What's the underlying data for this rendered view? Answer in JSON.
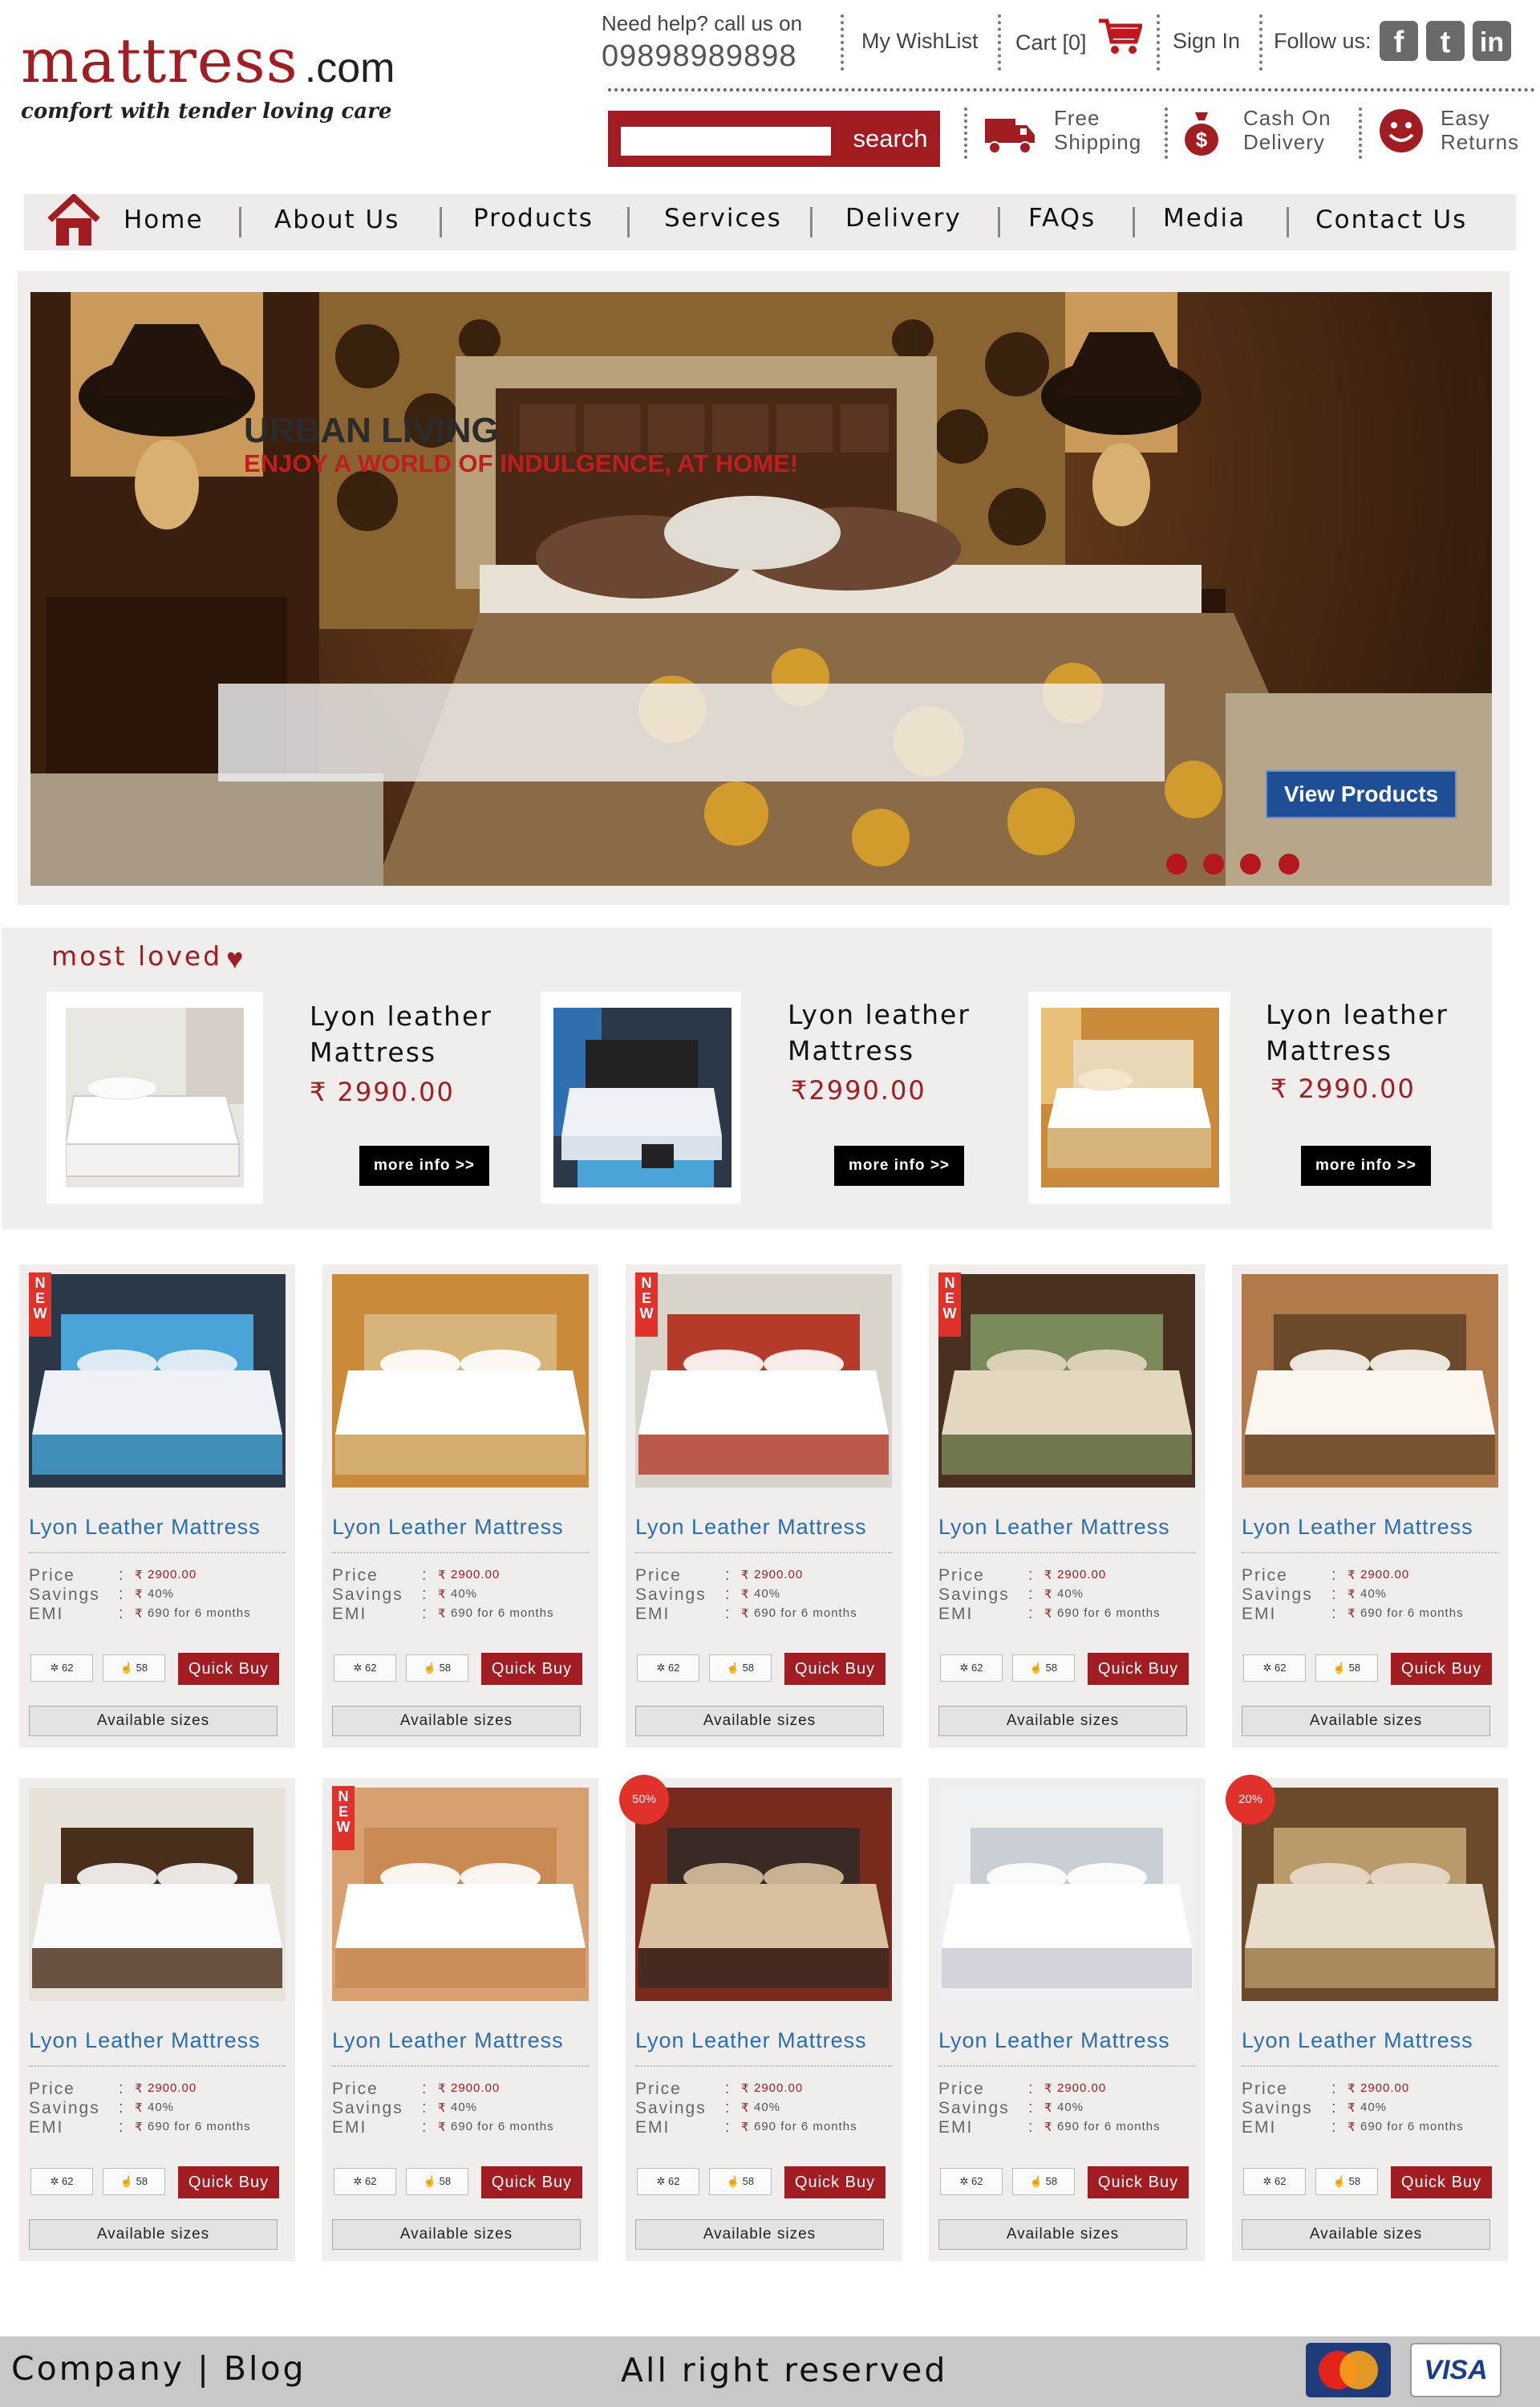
{
  "brand": {
    "logo_main": "mattress",
    "logo_domain": ".com",
    "tagline": "comfort with tender loving care",
    "accent_color": "#a11d21"
  },
  "header": {
    "help_text": "Need help? call us on",
    "phone": "09898989898",
    "wishlist": "My WishList",
    "cart": "Cart [0]",
    "signin": "Sign In",
    "follow": "Follow us:",
    "social": [
      "f",
      "t",
      "in"
    ],
    "search_placeholder": "",
    "search_button": "search",
    "features": [
      {
        "icon": "truck-icon",
        "line1": "Free",
        "line2": "Shipping"
      },
      {
        "icon": "money-bag-icon",
        "line1": "Cash On",
        "line2": "Delivery"
      },
      {
        "icon": "smiley-icon",
        "line1": "Easy",
        "line2": "Returns"
      }
    ]
  },
  "nav": [
    "Home",
    "About Us",
    "Products",
    "Services",
    "Delivery",
    "FAQs",
    "Media",
    "Contact Us"
  ],
  "hero": {
    "title": "URBAN LIVING",
    "subtitle": "ENJOY A WORLD OF INDULGENCE, AT HOME!",
    "button": "View Products",
    "slides": 4
  },
  "most_loved": {
    "title": "most loved",
    "items": [
      {
        "name_line1": "Lyon leather",
        "name_line2": "Mattress",
        "price": "2990.00",
        "button": "more info >>"
      },
      {
        "name_line1": "Lyon leather",
        "name_line2": "Mattress",
        "price": "2990.00",
        "button": "more info >>"
      },
      {
        "name_line1": "Lyon leather",
        "name_line2": "Mattress",
        "price": "2990.00",
        "button": "more info >>"
      }
    ]
  },
  "labels": {
    "price": "Price",
    "savings": "Savings",
    "emi": "EMI",
    "colon": ":",
    "quick_buy": "Quick Buy",
    "available_sizes": "Available sizes",
    "new": "NEW",
    "rupee": "₹"
  },
  "products": [
    {
      "name": "Lyon Leather Mattress",
      "price": "2900.00",
      "savings": "40%",
      "emi": "690 for 6 months",
      "likes": "62",
      "votes": "58",
      "badge": "new",
      "discount": ""
    },
    {
      "name": "Lyon Leather Mattress",
      "price": "2900.00",
      "savings": "40%",
      "emi": "690 for 6 months",
      "likes": "62",
      "votes": "58",
      "badge": "",
      "discount": ""
    },
    {
      "name": "Lyon Leather Mattress",
      "price": "2900.00",
      "savings": "40%",
      "emi": "690 for 6 months",
      "likes": "62",
      "votes": "58",
      "badge": "new",
      "discount": ""
    },
    {
      "name": "Lyon Leather Mattress",
      "price": "2900.00",
      "savings": "40%",
      "emi": "690 for 6 months",
      "likes": "62",
      "votes": "58",
      "badge": "new",
      "discount": ""
    },
    {
      "name": "Lyon Leather Mattress",
      "price": "2900.00",
      "savings": "40%",
      "emi": "690 for 6 months",
      "likes": "62",
      "votes": "58",
      "badge": "",
      "discount": ""
    },
    {
      "name": "Lyon Leather Mattress",
      "price": "2900.00",
      "savings": "40%",
      "emi": "690 for 6 months",
      "likes": "62",
      "votes": "58",
      "badge": "",
      "discount": ""
    },
    {
      "name": "Lyon Leather Mattress",
      "price": "2900.00",
      "savings": "40%",
      "emi": "690 for 6 months",
      "likes": "62",
      "votes": "58",
      "badge": "new",
      "discount": ""
    },
    {
      "name": "Lyon Leather Mattress",
      "price": "2900.00",
      "savings": "40%",
      "emi": "690 for 6 months",
      "likes": "62",
      "votes": "58",
      "badge": "",
      "discount": "50%"
    },
    {
      "name": "Lyon Leather Mattress",
      "price": "2900.00",
      "savings": "40%",
      "emi": "690 for 6 months",
      "likes": "62",
      "votes": "58",
      "badge": "",
      "discount": ""
    },
    {
      "name": "Lyon Leather Mattress",
      "price": "2900.00",
      "savings": "40%",
      "emi": "690 for 6 months",
      "likes": "62",
      "votes": "58",
      "badge": "",
      "discount": "20%"
    }
  ],
  "footer": {
    "left": "Company | Blog",
    "center": "All right reserved",
    "cards": [
      "MasterCard",
      "VISA"
    ]
  }
}
